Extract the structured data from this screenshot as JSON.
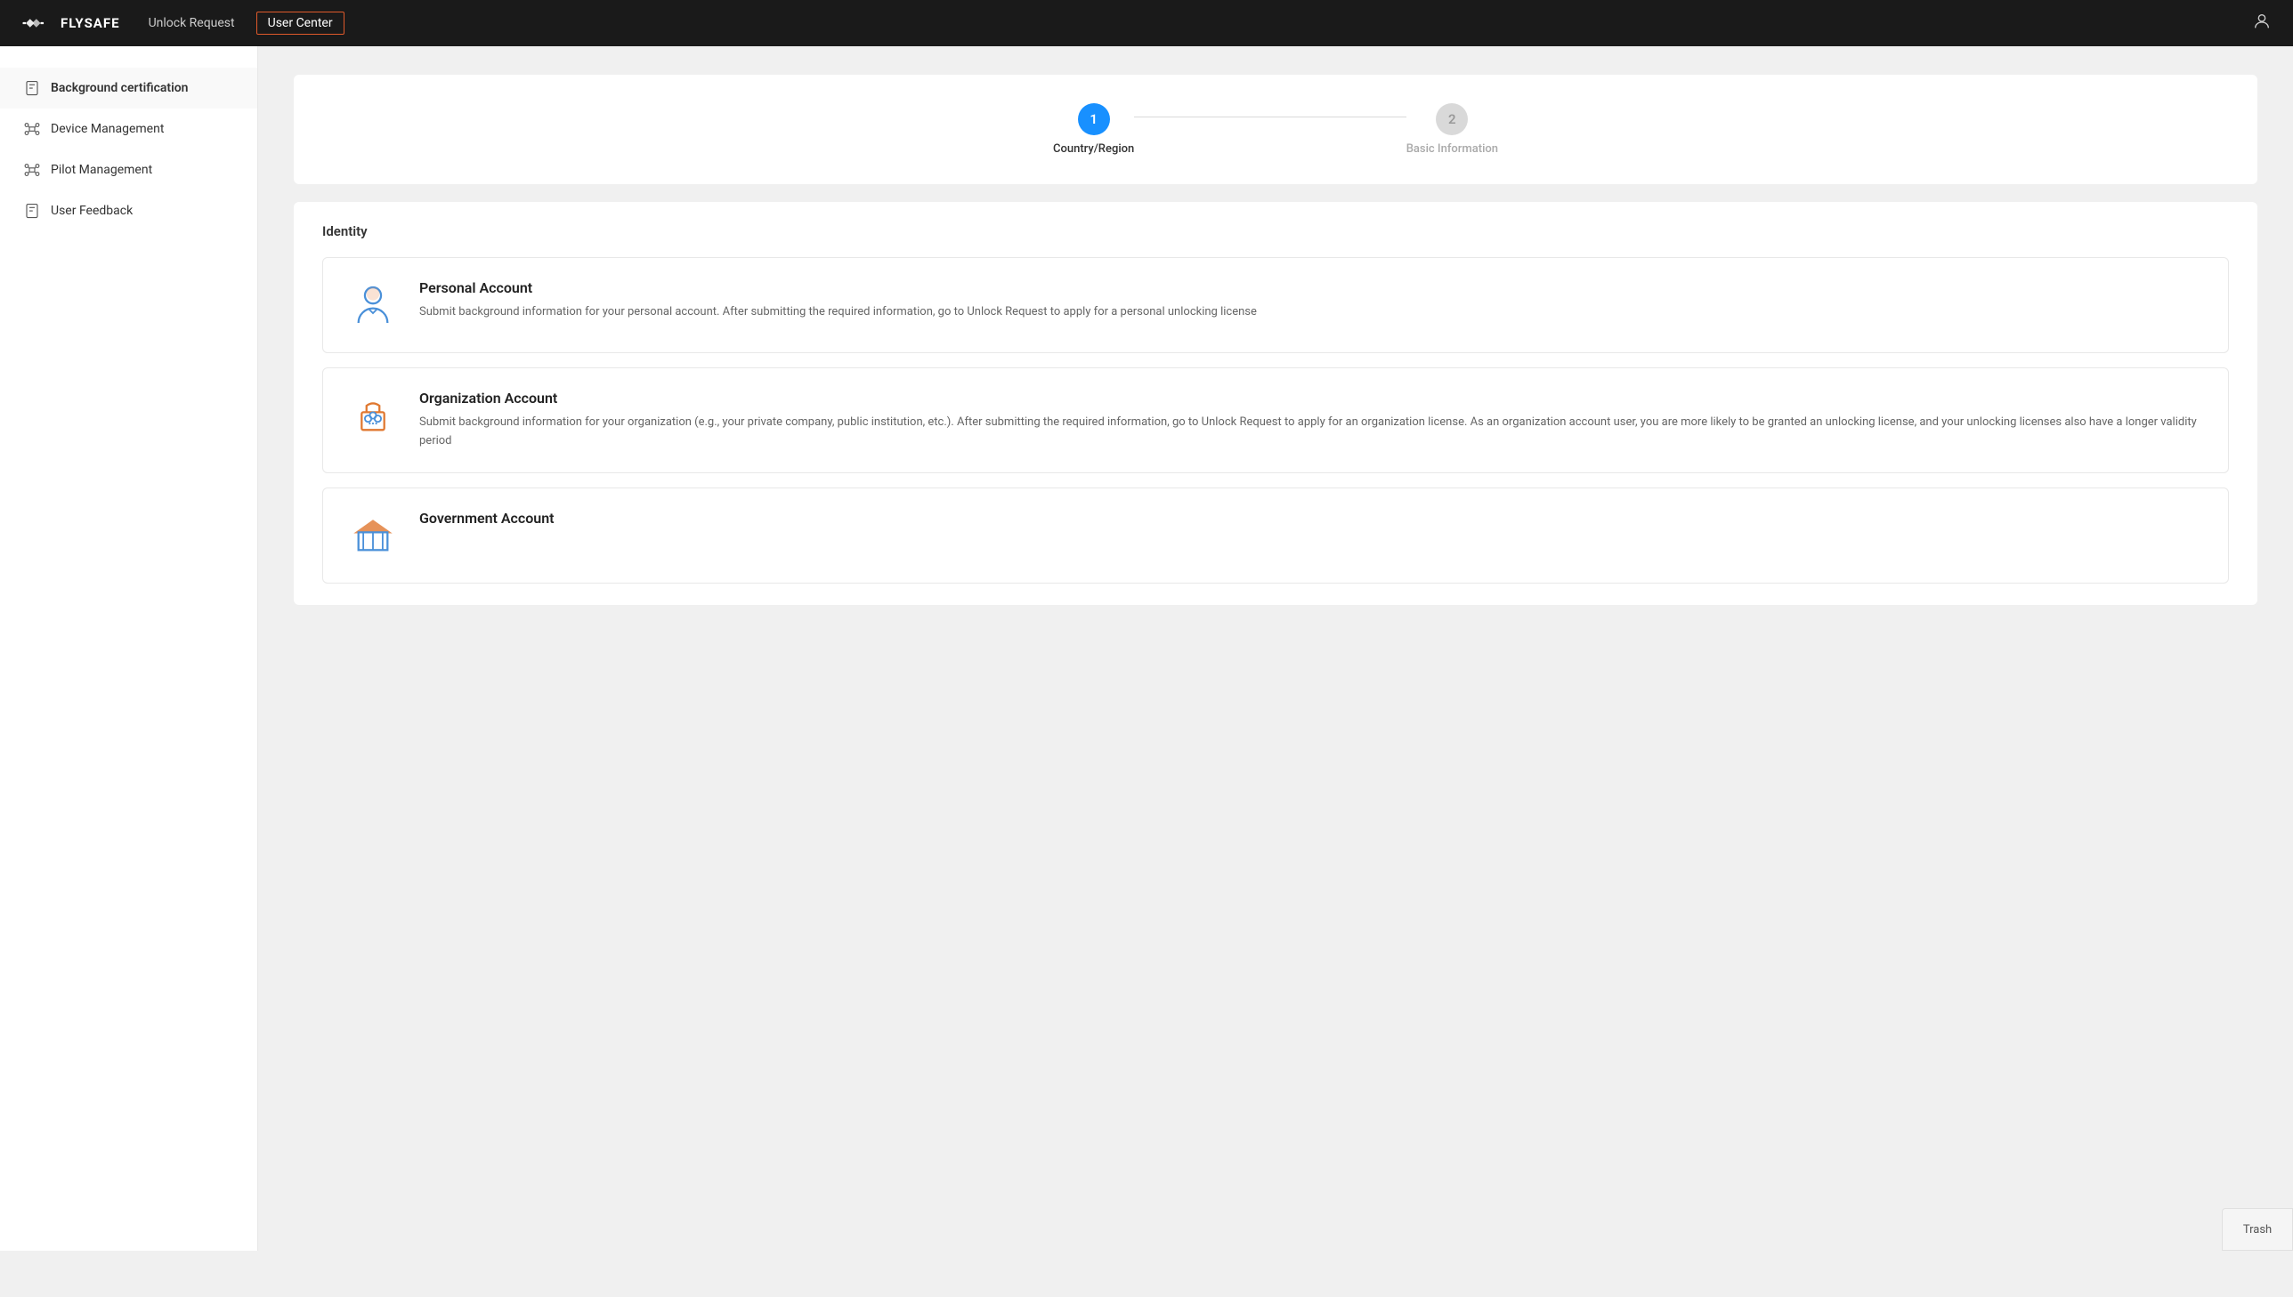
{
  "brand": {
    "name": "FLYSAFE"
  },
  "nav": {
    "unlock_request": "Unlock Request",
    "user_center": "User Center",
    "active": "user_center"
  },
  "sidebar": {
    "items": [
      {
        "id": "background-certification",
        "label": "Background certification",
        "icon": "document",
        "active": true
      },
      {
        "id": "device-management",
        "label": "Device Management",
        "icon": "drone",
        "active": false
      },
      {
        "id": "pilot-management",
        "label": "Pilot Management",
        "icon": "pilot",
        "active": false
      },
      {
        "id": "user-feedback",
        "label": "User Feedback",
        "icon": "feedback",
        "active": false
      }
    ]
  },
  "stepper": {
    "step1_num": "1",
    "step1_label": "Country/Region",
    "step2_num": "2",
    "step2_label": "Basic Information"
  },
  "identity": {
    "title": "Identity",
    "accounts": [
      {
        "id": "personal",
        "title": "Personal Account",
        "desc": "Submit background information for your personal account. After submitting the required information, go to Unlock Request to apply for a personal unlocking license"
      },
      {
        "id": "organization",
        "title": "Organization Account",
        "desc": "Submit background information for your organization (e.g., your private company, public institution, etc.). After submitting the required information, go to Unlock Request to apply for an organization license. As an organization account user, you are more likely to be granted an unlocking license, and your unlocking licenses also have a longer validity period"
      },
      {
        "id": "government",
        "title": "Government Account",
        "desc": ""
      }
    ]
  },
  "trash": {
    "label": "Trash"
  }
}
